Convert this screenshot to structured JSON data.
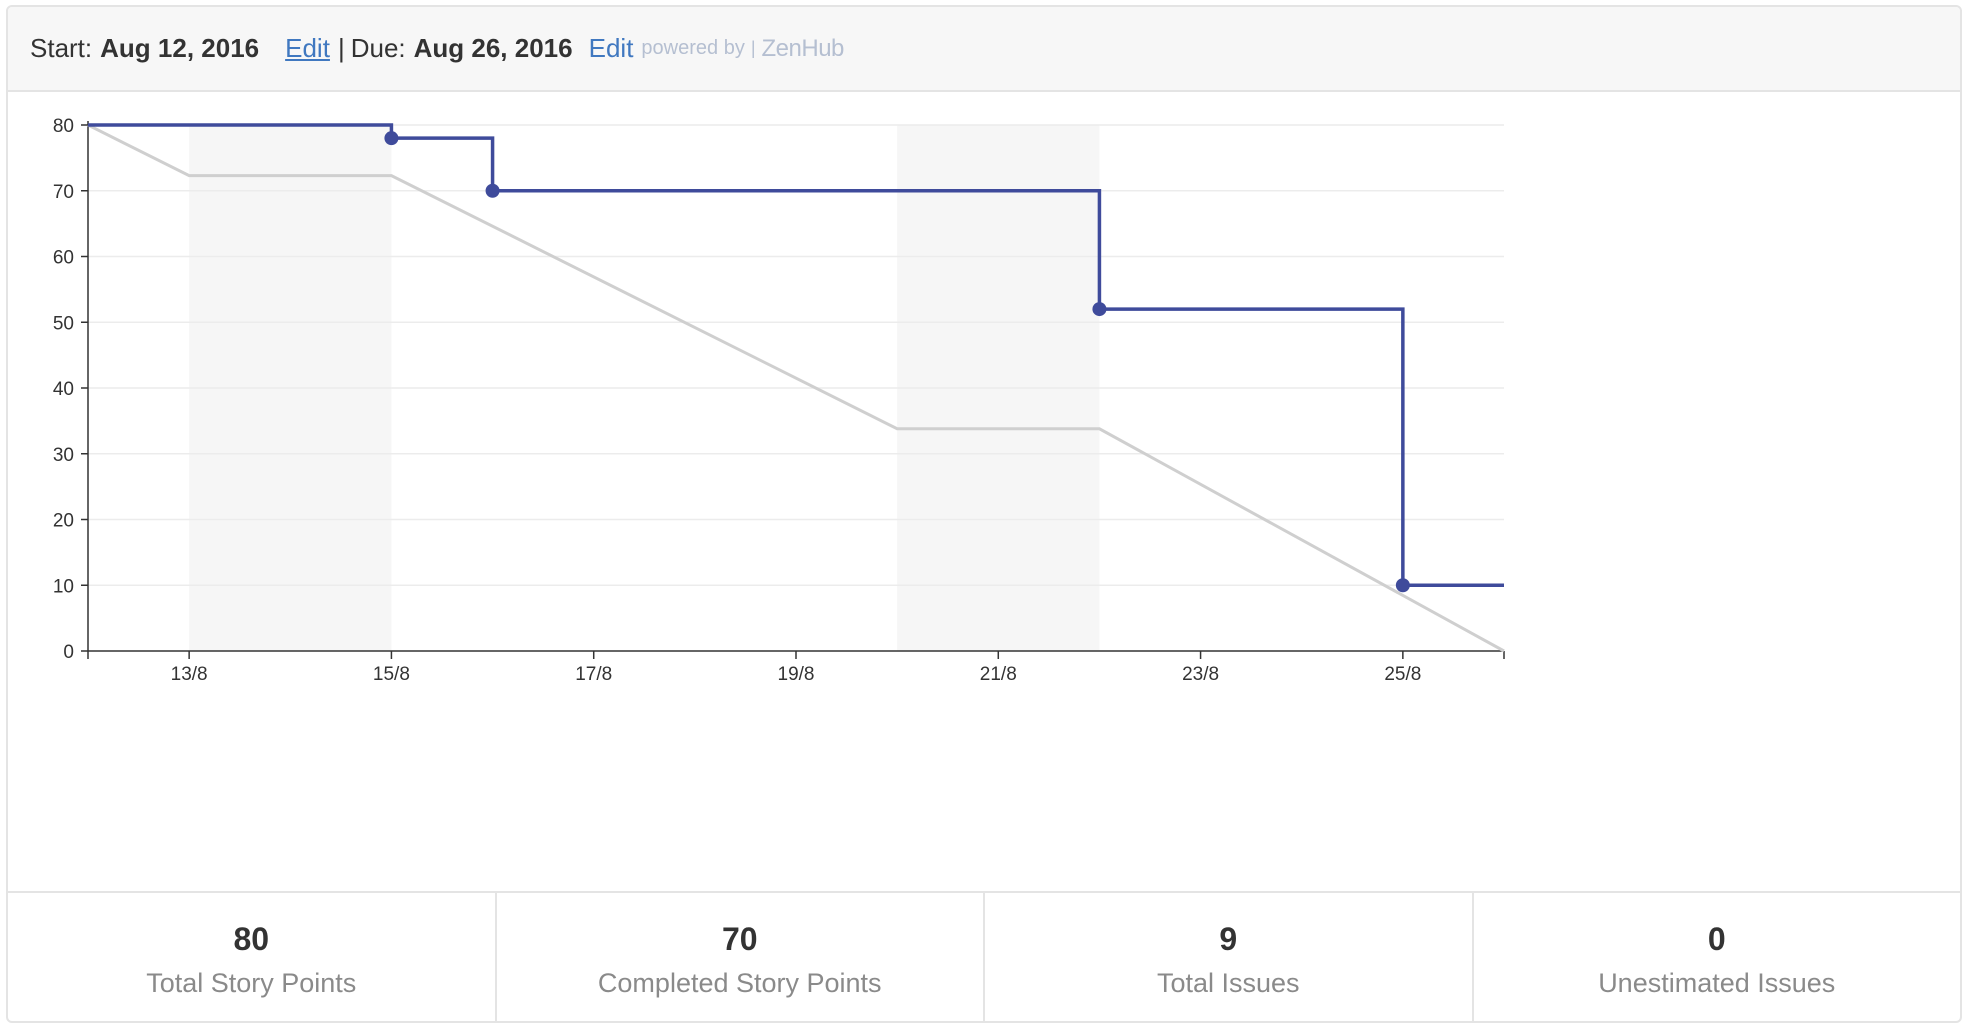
{
  "header": {
    "start_label": "Start:",
    "start_date": "Aug 12, 2016",
    "edit_start": "Edit",
    "separator": "|",
    "due_label": "Due:",
    "due_date": "Aug 26, 2016",
    "edit_due": "Edit",
    "powered_by": "powered by",
    "brand_separator": "|",
    "brand": "ZenHub"
  },
  "chart_data": {
    "type": "line",
    "title": "",
    "xlabel": "",
    "ylabel": "",
    "x_domain": [
      "12/8",
      "26/8"
    ],
    "ylim": [
      0,
      80
    ],
    "yticks": [
      "0",
      "10",
      "20",
      "30",
      "40",
      "50",
      "60",
      "70",
      "80"
    ],
    "xtick_labels": [
      "13/8",
      "15/8",
      "17/8",
      "19/8",
      "21/8",
      "23/8",
      "25/8"
    ],
    "grid": true,
    "weekend_bands": [
      [
        "13/8",
        "15/8"
      ],
      [
        "20/8",
        "22/8"
      ]
    ],
    "series": [
      {
        "color": "#cfcfcf",
        "points": [
          {
            "x": "12/8",
            "y": 80
          },
          {
            "x": "13/8",
            "y": 72.3
          },
          {
            "x": "15/8",
            "y": 72.3
          },
          {
            "x": "20/8",
            "y": 33.8
          },
          {
            "x": "22/8",
            "y": 33.8
          },
          {
            "x": "26/8",
            "y": 0
          }
        ]
      },
      {
        "color": "#3f4b9b",
        "step": true,
        "points": [
          {
            "x": "12/8",
            "y": 80
          },
          {
            "x": "15/8",
            "y": 78
          },
          {
            "x": "16/8",
            "y": 70
          },
          {
            "x": "22/8",
            "y": 52
          },
          {
            "x": "25/8",
            "y": 10
          },
          {
            "x": "26/8",
            "y": 10
          }
        ],
        "markers": [
          "15/8",
          "16/8",
          "22/8",
          "25/8"
        ]
      }
    ]
  },
  "stats": [
    {
      "value": "80",
      "label": "Total Story Points"
    },
    {
      "value": "70",
      "label": "Completed Story Points"
    },
    {
      "value": "9",
      "label": "Total Issues"
    },
    {
      "value": "0",
      "label": "Unestimated Issues"
    }
  ]
}
